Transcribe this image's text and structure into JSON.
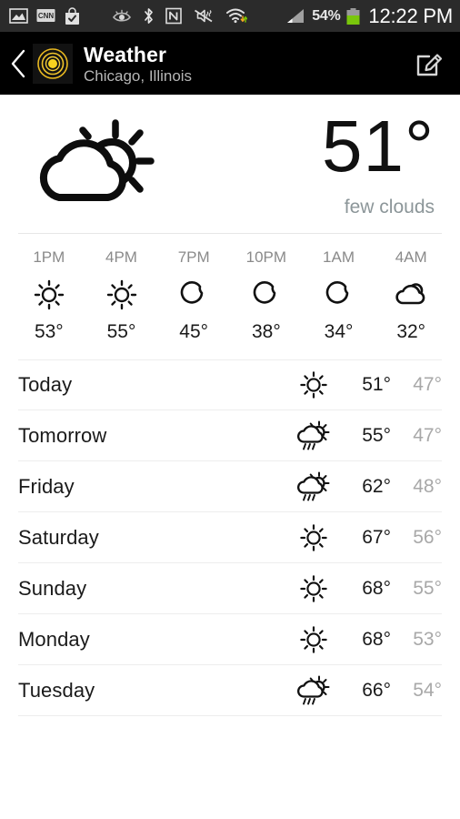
{
  "status_bar": {
    "icons": [
      "gallery-icon",
      "cnn-icon",
      "play-store-bag-icon",
      "smart-stay-eye-icon",
      "bluetooth-icon",
      "nfc-icon",
      "vibrate-mute-icon",
      "wifi-icon"
    ],
    "battery_percent": "54%",
    "clock": "12:22 PM",
    "background": "#2b2b2b"
  },
  "action_bar": {
    "title": "Weather",
    "subtitle": "Chicago, Illinois",
    "back_label": "Back",
    "edit_label": "Edit",
    "accent": "#f2c829",
    "background": "#000000"
  },
  "current": {
    "icon": "sun-behind-cloud-icon",
    "temperature": "51°",
    "description": "few clouds"
  },
  "hourly": [
    {
      "time": "1PM",
      "icon": "sun-icon",
      "temp": "53°"
    },
    {
      "time": "4PM",
      "icon": "sun-icon",
      "temp": "55°"
    },
    {
      "time": "7PM",
      "icon": "moon-icon",
      "temp": "45°"
    },
    {
      "time": "10PM",
      "icon": "moon-icon",
      "temp": "38°"
    },
    {
      "time": "1AM",
      "icon": "moon-icon",
      "temp": "34°"
    },
    {
      "time": "4AM",
      "icon": "cloud-icon",
      "temp": "32°"
    }
  ],
  "daily": [
    {
      "day": "Today",
      "icon": "sun-icon",
      "high": "51°",
      "low": "47°"
    },
    {
      "day": "Tomorrow",
      "icon": "rain-sun-cloud-icon",
      "high": "55°",
      "low": "47°"
    },
    {
      "day": "Friday",
      "icon": "rain-sun-cloud-icon",
      "high": "62°",
      "low": "48°"
    },
    {
      "day": "Saturday",
      "icon": "sun-icon",
      "high": "67°",
      "low": "56°"
    },
    {
      "day": "Sunday",
      "icon": "sun-icon",
      "high": "68°",
      "low": "55°"
    },
    {
      "day": "Monday",
      "icon": "sun-icon",
      "high": "68°",
      "low": "53°"
    },
    {
      "day": "Tuesday",
      "icon": "rain-sun-cloud-icon",
      "high": "66°",
      "low": "54°"
    }
  ]
}
